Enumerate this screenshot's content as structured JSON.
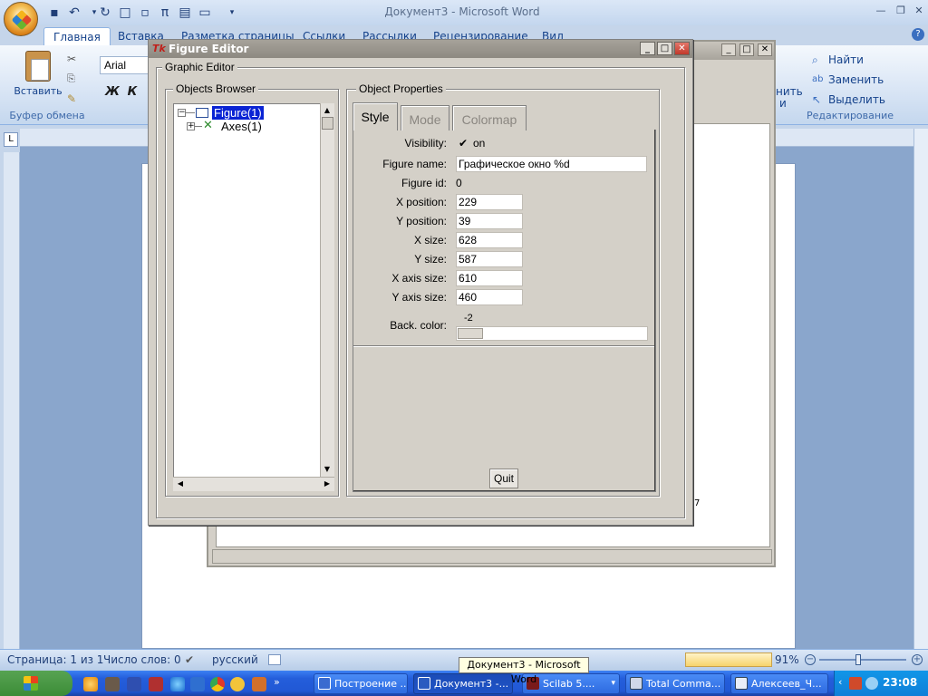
{
  "word": {
    "window_title": "Документ3 - Microsoft Word",
    "ribbon_tabs": [
      "Главная",
      "Вставка",
      "Разметка страницы",
      "Ссылки",
      "Рассылки",
      "Рецензирование",
      "Вид"
    ],
    "paste_label": "Вставить",
    "clipboard_group": "Буфер обмена",
    "font_name": "Arial",
    "bold_label": "Ж",
    "italic_label": "К",
    "edit_find": "Найти",
    "edit_replace": "Заменить",
    "edit_select": "Выделить",
    "edit_group": "Редактирование",
    "partial_styles": "нить",
    "partial_styles2": "и",
    "status": {
      "page": "Страница: 1 из 1",
      "words": "Число слов: 0",
      "language": "русский",
      "zoom": "91%"
    },
    "tooltip": "Документ3 - Microsoft Word"
  },
  "taskbar": {
    "items": [
      {
        "label": "Построение ..."
      },
      {
        "label": "Документ3 -..."
      },
      {
        "label": "Scilab 5...."
      },
      {
        "label": "Total Comma..."
      },
      {
        "label": "Алексеев_Ч..."
      }
    ],
    "clock": "23:08"
  },
  "figure_editor": {
    "title": "Figure Editor",
    "tk_logo": "Tk",
    "graphic_editor_label": "Graphic Editor",
    "objects_browser_label": "Objects Browser",
    "object_properties_label": "Object Properties",
    "tree": [
      {
        "label": "Figure(1)",
        "selected": true,
        "expander": "⊟"
      },
      {
        "label": "Axes(1)",
        "selected": false,
        "expander": "⊞"
      }
    ],
    "tabs": [
      "Style",
      "Mode",
      "Colormap"
    ],
    "properties": {
      "visibility_label": "Visibility:",
      "visibility_value": "on",
      "figure_name_label": "Figure name:",
      "figure_name_value": "Графическое окно %d",
      "figure_id_label": "Figure id:",
      "figure_id_value": "0",
      "x_position_label": "X position:",
      "x_position_value": "229",
      "y_position_label": "Y position:",
      "y_position_value": "39",
      "x_size_label": "X size:",
      "x_size_value": "628",
      "y_size_label": "Y size:",
      "y_size_value": "587",
      "x_axis_size_label": "X axis size:",
      "x_axis_size_value": "610",
      "y_axis_size_label": "Y axis size:",
      "y_axis_size_value": "460",
      "back_color_label": "Back. color:",
      "back_color_value": "-2"
    },
    "quit_label": "Quit"
  },
  "background_window": {
    "partial_text": "7"
  },
  "colors": {
    "selection": "#0a24d4",
    "dialog_bg": "#d4d0c8",
    "word_accent": "#15428b",
    "taskbar": "#245edb"
  }
}
